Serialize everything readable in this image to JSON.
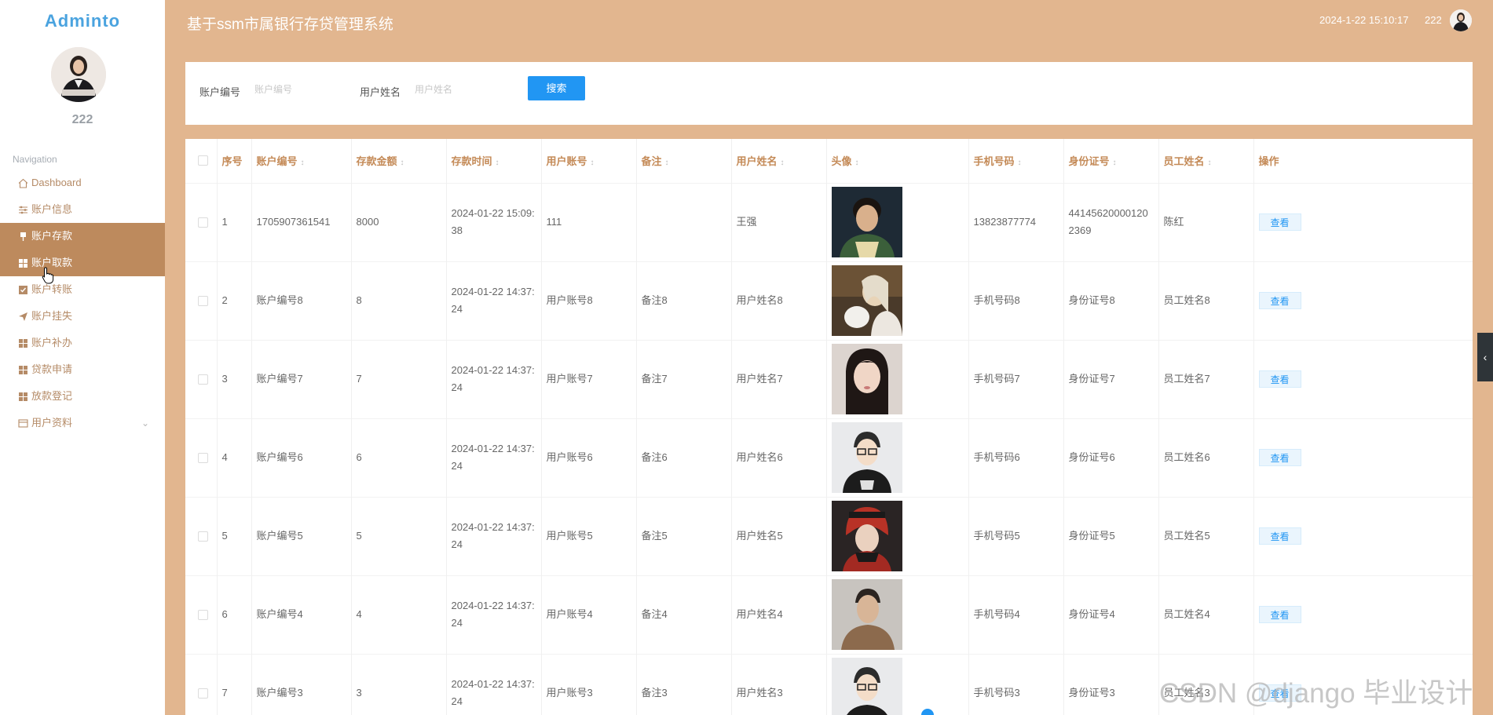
{
  "sidebar": {
    "logo": "Adminto",
    "username": "222",
    "nav_title": "Navigation",
    "items": [
      {
        "label": "Dashboard",
        "icon": "home-icon"
      },
      {
        "label": "账户信息",
        "icon": "sliders-icon"
      },
      {
        "label": "账户存款",
        "icon": "pin-icon"
      },
      {
        "label": "账户取款",
        "icon": "grid-icon"
      },
      {
        "label": "账户转账",
        "icon": "check-square-icon"
      },
      {
        "label": "账户挂失",
        "icon": "send-icon"
      },
      {
        "label": "账户补办",
        "icon": "grid-icon"
      },
      {
        "label": "贷款申请",
        "icon": "grid-icon"
      },
      {
        "label": "放款登记",
        "icon": "grid-icon"
      },
      {
        "label": "用户资料",
        "icon": "window-icon"
      }
    ]
  },
  "header": {
    "title": "基于ssm市属银行存贷管理系统",
    "datetime": "2024-1-22 15:10:17",
    "username": "222"
  },
  "search": {
    "account_no_label": "账户编号",
    "account_no_placeholder": "账户编号",
    "account_no_value": "",
    "user_name_label": "用户姓名",
    "user_name_placeholder": "用户姓名",
    "user_name_value": "",
    "button_label": "搜索"
  },
  "table": {
    "headers": [
      "序号",
      "账户编号",
      "存款金额",
      "存款时间",
      "用户账号",
      "备注",
      "用户姓名",
      "头像",
      "手机号码",
      "身份证号",
      "员工姓名",
      "操作"
    ],
    "view_label": "查看",
    "rows": [
      {
        "seq": "1",
        "account_no": "1705907361541",
        "amount": "8000",
        "time": "2024-01-22 15:09:38",
        "user_account": "111",
        "remark": "",
        "user_name": "王强",
        "phone": "13823877774",
        "id_no": "441456200001202369",
        "staff": "陈红"
      },
      {
        "seq": "2",
        "account_no": "账户编号8",
        "amount": "8",
        "time": "2024-01-22 14:37:24",
        "user_account": "用户账号8",
        "remark": "备注8",
        "user_name": "用户姓名8",
        "phone": "手机号码8",
        "id_no": "身份证号8",
        "staff": "员工姓名8"
      },
      {
        "seq": "3",
        "account_no": "账户编号7",
        "amount": "7",
        "time": "2024-01-22 14:37:24",
        "user_account": "用户账号7",
        "remark": "备注7",
        "user_name": "用户姓名7",
        "phone": "手机号码7",
        "id_no": "身份证号7",
        "staff": "员工姓名7"
      },
      {
        "seq": "4",
        "account_no": "账户编号6",
        "amount": "6",
        "time": "2024-01-22 14:37:24",
        "user_account": "用户账号6",
        "remark": "备注6",
        "user_name": "用户姓名6",
        "phone": "手机号码6",
        "id_no": "身份证号6",
        "staff": "员工姓名6"
      },
      {
        "seq": "5",
        "account_no": "账户编号5",
        "amount": "5",
        "time": "2024-01-22 14:37:24",
        "user_account": "用户账号5",
        "remark": "备注5",
        "user_name": "用户姓名5",
        "phone": "手机号码5",
        "id_no": "身份证号5",
        "staff": "员工姓名5"
      },
      {
        "seq": "6",
        "account_no": "账户编号4",
        "amount": "4",
        "time": "2024-01-22 14:37:24",
        "user_account": "用户账号4",
        "remark": "备注4",
        "user_name": "用户姓名4",
        "phone": "手机号码4",
        "id_no": "身份证号4",
        "staff": "员工姓名4"
      },
      {
        "seq": "7",
        "account_no": "账户编号3",
        "amount": "3",
        "time": "2024-01-22 14:37:24",
        "user_account": "用户账号3",
        "remark": "备注3",
        "user_name": "用户姓名3",
        "phone": "手机号码3",
        "id_no": "身份证号3",
        "staff": "员工姓名3"
      }
    ]
  },
  "watermark": "CSDN @django 毕业设计",
  "colors": {
    "header_bg": "#e2b68f",
    "active_nav": "#bd8a5d",
    "primary": "#2196f3",
    "table_header_text": "#c48a57"
  }
}
